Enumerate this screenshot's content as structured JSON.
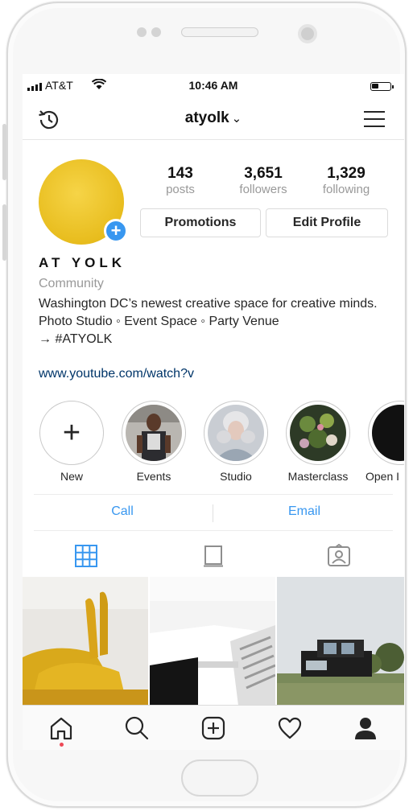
{
  "status_bar": {
    "carrier": "AT&T",
    "time": "10:46 AM"
  },
  "header": {
    "username": "atyolk",
    "caret": "⌄"
  },
  "profile": {
    "stats": [
      {
        "value": "143",
        "label": "posts"
      },
      {
        "value": "3,651",
        "label": "followers"
      },
      {
        "value": "1,329",
        "label": "following"
      }
    ],
    "buttons": {
      "promotions": "Promotions",
      "edit_profile": "Edit Profile"
    },
    "name": "AT YOLK",
    "category": "Community",
    "bio_lines": [
      "Washington DC’s newest creative space for creative minds.",
      "Photo Studio ◦ Event Space ◦ Party Venue",
      "→ #ATYOLK"
    ],
    "link": "www.youtube.com/watch?v",
    "avatar_color": "#eec52a",
    "accent_color": "#3897f0"
  },
  "highlights": [
    {
      "label": "New"
    },
    {
      "label": "Events"
    },
    {
      "label": "Studio"
    },
    {
      "label": "Masterclass"
    },
    {
      "label": "Open I"
    }
  ],
  "contact": {
    "call": "Call",
    "email": "Email"
  },
  "icons": {
    "header": [
      "history-icon",
      "chevron-down-icon",
      "menu-icon"
    ],
    "tabs": [
      "grid-icon",
      "feed-icon",
      "tagged-icon"
    ],
    "nav": [
      "home-icon",
      "search-icon",
      "add-post-icon",
      "heart-icon",
      "profile-icon"
    ]
  }
}
